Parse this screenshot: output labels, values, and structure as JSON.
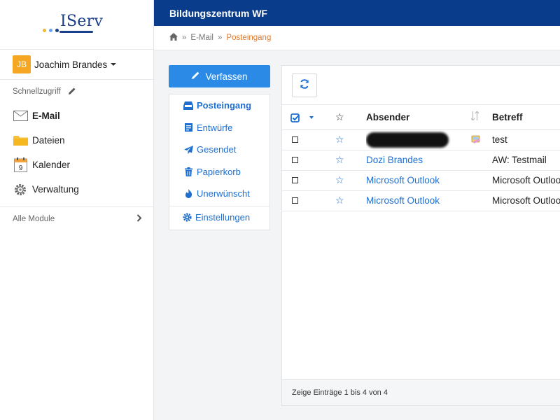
{
  "app": {
    "logo_text": "IServ",
    "school_name": "Bildungszentrum WF"
  },
  "colors": {
    "brand": "#0a3c8c",
    "accent": "#2b8ae6",
    "link": "#1f6fd1",
    "breadcrumb_active": "#e07b2f",
    "avatar": "#f5a623"
  },
  "user": {
    "initials": "JB",
    "name": "Joachim Brandes"
  },
  "sidebar": {
    "quick_access_label": "Schnellzugriff",
    "items": [
      {
        "label": "E-Mail",
        "icon": "envelope-icon",
        "active": true
      },
      {
        "label": "Dateien",
        "icon": "folder-icon",
        "active": false
      },
      {
        "label": "Kalender",
        "icon": "calendar-icon",
        "calendar_day": "9",
        "active": false
      },
      {
        "label": "Verwaltung",
        "icon": "gear-icon",
        "active": false
      }
    ],
    "all_modules_label": "Alle Module"
  },
  "breadcrumb": {
    "items": [
      "E-Mail",
      "Posteingang"
    ]
  },
  "mail": {
    "compose_label": "Verfassen",
    "folders": [
      {
        "label": "Posteingang",
        "icon": "inbox-icon",
        "active": true
      },
      {
        "label": "Entwürfe",
        "icon": "drafts-icon"
      },
      {
        "label": "Gesendet",
        "icon": "send-icon"
      },
      {
        "label": "Papierkorb",
        "icon": "trash-icon"
      },
      {
        "label": "Unerwünscht",
        "icon": "flame-icon"
      }
    ],
    "settings_label": "Einstellungen",
    "table": {
      "columns": {
        "sender": "Absender",
        "subject": "Betreff"
      },
      "rows": [
        {
          "sender": "",
          "sender_redacted": true,
          "subject": "test",
          "has_attachment_icon": true
        },
        {
          "sender": "Dozi Brandes",
          "subject": "AW: Testmail"
        },
        {
          "sender": "Microsoft Outlook",
          "subject": "Microsoft Outlook-"
        },
        {
          "sender": "Microsoft Outlook",
          "subject": "Microsoft Outlook-"
        }
      ]
    },
    "footer_text": "Zeige Einträge 1 bis 4 von 4"
  }
}
